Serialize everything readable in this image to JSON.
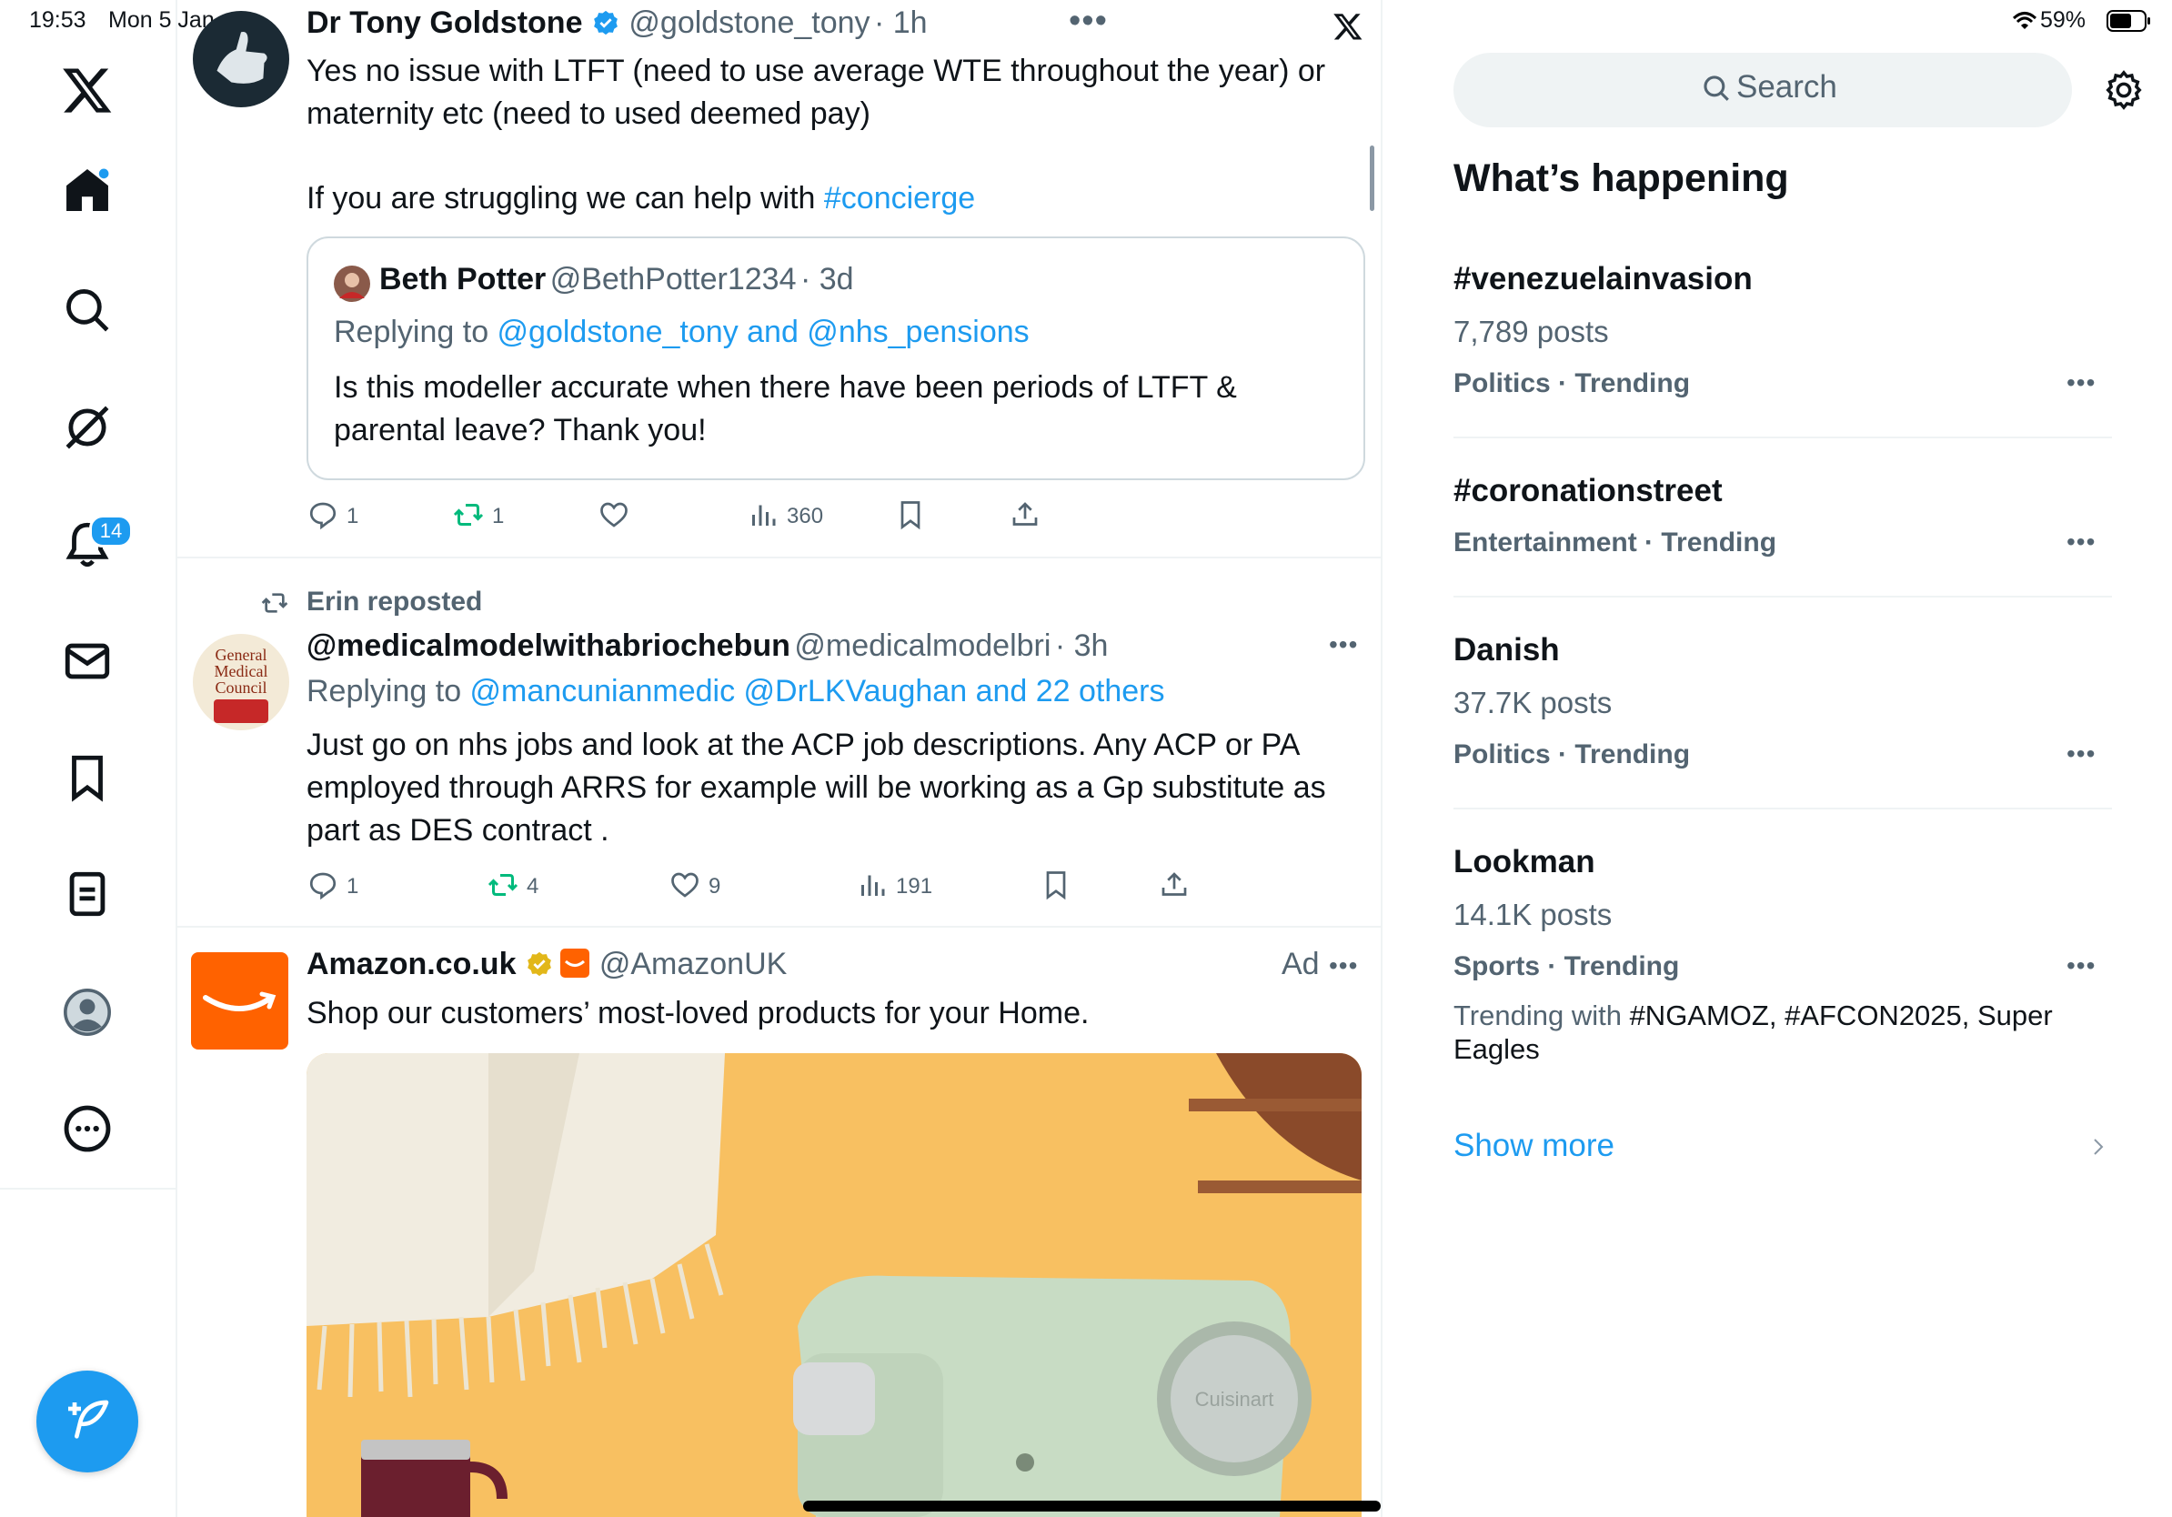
{
  "status_bar": {
    "time": "19:53",
    "date": "Mon 5 Jan",
    "battery": "59%"
  },
  "nav": {
    "notifications_badge": "14",
    "icons": [
      "x-logo",
      "home-icon",
      "search-icon",
      "grok-icon",
      "notifications-icon",
      "messages-icon",
      "bookmarks-icon",
      "lists-icon",
      "profile-icon",
      "more-icon"
    ]
  },
  "tweet1": {
    "name": "Dr Tony Goldstone",
    "handle": "@goldstone_tony",
    "time": "· 1h",
    "text_line1": "Yes no issue with LTFT (need to use average WTE throughout the year) or",
    "text_line2": "maternity etc (need to used deemed pay)",
    "text_line3": "If you are struggling we can help with ",
    "hashtag": "#concierge",
    "quote": {
      "name": "Beth Potter",
      "handle": "@BethPotter1234",
      "time": "· 3d",
      "replying_prefix": "Replying to ",
      "replying_to": "@goldstone_tony and @nhs_pensions",
      "text_line1": "Is this modeller accurate when there have been periods of LTFT &",
      "text_line2": "parental leave? Thank you!"
    },
    "replies": "1",
    "reposts": "1",
    "views": "360"
  },
  "tweet2": {
    "reposted_by": "Erin reposted",
    "name": "@medicalmodelwithabriochebun",
    "handle": "@medicalmodelbri",
    "time": "· 3h",
    "replying_prefix": "Replying to ",
    "replying_to": "@mancunianmedic @DrLKVaughan and 22 others",
    "avatar_text_1": "General",
    "avatar_text_2": "Medical",
    "avatar_text_3": "Council",
    "text_line1": "Just go on nhs jobs and look at the ACP job descriptions. Any ACP or PA",
    "text_line2": "employed through ARRS for example will be working as a Gp substitute as",
    "text_line3": "part as DES contract .",
    "replies": "1",
    "reposts": "4",
    "likes": "9",
    "views": "191"
  },
  "tweet3": {
    "name": "Amazon.co.uk",
    "handle": "@AmazonUK",
    "ad_label": "Ad",
    "text": "Shop our customers’ most-loved products for your Home.",
    "image_text": "Cuisinart"
  },
  "sidebar": {
    "search_placeholder": "Search",
    "heading": "What’s happening",
    "trends": [
      {
        "title": "#venezuelainvasion",
        "posts": "7,789 posts",
        "category": "Politics · Trending"
      },
      {
        "title": "#coronationstreet",
        "category": "Entertainment · Trending"
      },
      {
        "title": "Danish",
        "posts": "37.7K posts",
        "category": "Politics · Trending"
      },
      {
        "title": "Lookman",
        "posts": "14.1K posts",
        "category": "Sports · Trending",
        "with_prefix": "Trending with ",
        "with_tags": "#NGAMOZ, #AFCON2025, Super",
        "with_tags_2": "Eagles"
      }
    ],
    "show_more": "Show more"
  },
  "colors": {
    "accent": "#1d9bf0",
    "repost_green": "#00ba7c",
    "amazon_orange": "#ff6200",
    "ad_background": "#f8c061"
  }
}
